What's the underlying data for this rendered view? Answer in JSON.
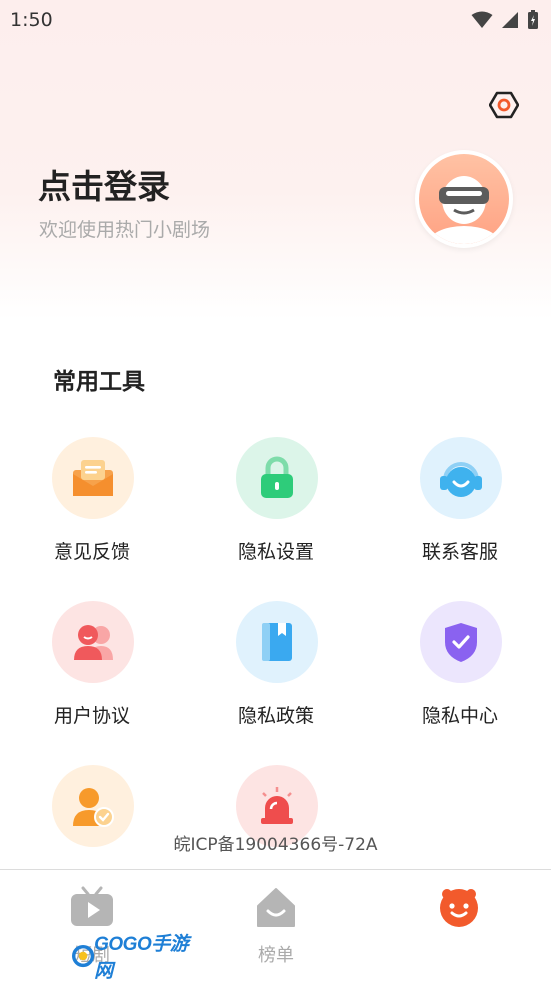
{
  "status": {
    "time": "1:50"
  },
  "header": {
    "title": "点击登录",
    "subtitle": "欢迎使用热门小剧场"
  },
  "tools": {
    "section_title": "常用工具",
    "items": [
      {
        "label": "意见反馈",
        "icon": "envelope-icon",
        "color": "#f7a24b"
      },
      {
        "label": "隐私设置",
        "icon": "lock-icon",
        "color": "#2ecc7a"
      },
      {
        "label": "联系客服",
        "icon": "headset-icon",
        "color": "#3fb2ee"
      },
      {
        "label": "用户协议",
        "icon": "users-icon",
        "color": "#f0595c"
      },
      {
        "label": "隐私政策",
        "icon": "book-icon",
        "color": "#3aa9f0"
      },
      {
        "label": "隐私中心",
        "icon": "shield-icon",
        "color": "#8a62f0"
      },
      {
        "label": "",
        "icon": "user-check-icon",
        "color": "#f79a2b"
      },
      {
        "label": "",
        "icon": "alarm-icon",
        "color": "#ef4d4d"
      }
    ]
  },
  "footer": {
    "icp": "皖ICP备19004366号-72A"
  },
  "tabbar": {
    "tabs": [
      {
        "label": "短剧",
        "icon": "tv-icon"
      },
      {
        "label": "榜单",
        "icon": "house-icon"
      },
      {
        "label": "",
        "icon": "smiley-icon",
        "active": true
      }
    ]
  },
  "watermark": {
    "text": "GOGO手游网"
  },
  "colors": {
    "accent": "#f25a2c",
    "inactive": "#b5b5b5"
  }
}
